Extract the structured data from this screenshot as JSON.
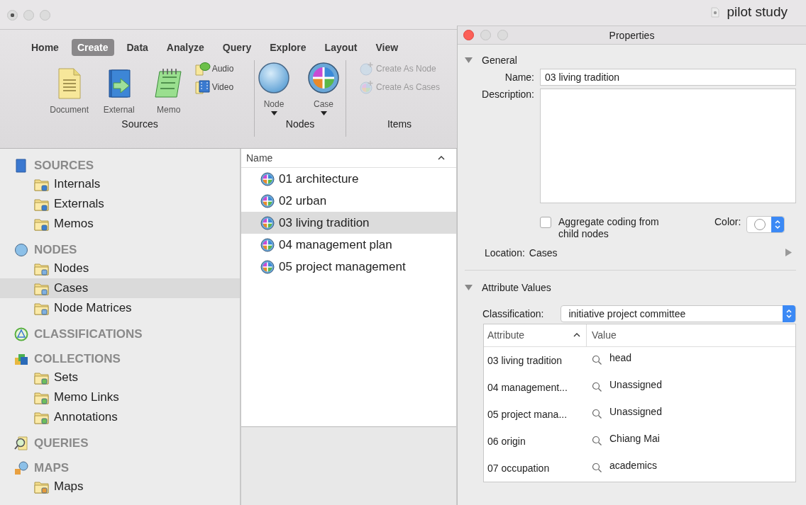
{
  "window": {
    "title": "pilot study"
  },
  "ribbon": {
    "tabs": [
      {
        "label": "Home",
        "selected": false
      },
      {
        "label": "Create",
        "selected": true
      },
      {
        "label": "Data",
        "selected": false
      },
      {
        "label": "Analyze",
        "selected": false
      },
      {
        "label": "Query",
        "selected": false
      },
      {
        "label": "Explore",
        "selected": false
      },
      {
        "label": "Layout",
        "selected": false
      },
      {
        "label": "View",
        "selected": false
      }
    ],
    "groups": [
      {
        "label": "Sources",
        "buttons": [
          {
            "label": "Document",
            "kind": "large",
            "disabled": false,
            "menu": false
          },
          {
            "label": "External",
            "kind": "large",
            "disabled": false,
            "menu": false
          },
          {
            "label": "Memo",
            "kind": "large",
            "disabled": false,
            "menu": false
          },
          {
            "label": "Audio",
            "kind": "small",
            "disabled": false
          },
          {
            "label": "Video",
            "kind": "small",
            "disabled": false
          }
        ]
      },
      {
        "label": "Nodes",
        "buttons": [
          {
            "label": "Node",
            "kind": "large",
            "disabled": false,
            "menu": true
          },
          {
            "label": "Case",
            "kind": "large",
            "disabled": false,
            "menu": true
          }
        ]
      },
      {
        "label": "Items",
        "buttons": [
          {
            "label": "Create As Node",
            "kind": "small",
            "disabled": true
          },
          {
            "label": "Create As Cases",
            "kind": "small",
            "disabled": true
          }
        ]
      }
    ]
  },
  "sidebar": {
    "sections": [
      {
        "label": "SOURCES",
        "items": [
          {
            "label": "Internals",
            "selected": false
          },
          {
            "label": "Externals",
            "selected": false
          },
          {
            "label": "Memos",
            "selected": false
          }
        ]
      },
      {
        "label": "NODES",
        "items": [
          {
            "label": "Nodes",
            "selected": false
          },
          {
            "label": "Cases",
            "selected": true
          },
          {
            "label": "Node Matrices",
            "selected": false
          }
        ]
      },
      {
        "label": "CLASSIFICATIONS"
      },
      {
        "label": "COLLECTIONS",
        "items": [
          {
            "label": "Sets",
            "selected": false
          },
          {
            "label": "Memo Links",
            "selected": false
          },
          {
            "label": "Annotations",
            "selected": false
          }
        ]
      },
      {
        "label": "QUERIES"
      },
      {
        "label": "MAPS",
        "items": [
          {
            "label": "Maps",
            "selected": false
          }
        ]
      }
    ]
  },
  "list": {
    "columns": [
      "Name"
    ],
    "rows": [
      {
        "label": "01 architecture",
        "selected": false
      },
      {
        "label": "02 urban",
        "selected": false
      },
      {
        "label": "03 living tradition",
        "selected": true
      },
      {
        "label": "04 management plan",
        "selected": false
      },
      {
        "label": "05 project management",
        "selected": false
      }
    ]
  },
  "properties": {
    "title": "Properties",
    "general": {
      "label": "General",
      "expanded": true,
      "name_label": "Name:",
      "name_value": "03 living tradition",
      "description_label": "Description:",
      "aggregate": {
        "label": "Aggregate coding from child nodes",
        "checked": false
      },
      "color_label": "Color:",
      "location_label": "Location:",
      "location_value": "Cases"
    },
    "attributes": {
      "label": "Attribute Values",
      "expanded": true,
      "classification_label": "Classification:",
      "classification_value": "initiative project committee",
      "columns": [
        "Attribute",
        "Value"
      ],
      "rows": [
        {
          "attribute": "03 living tradition",
          "value": "head"
        },
        {
          "attribute": "04 management...",
          "value": "Unassigned"
        },
        {
          "attribute": "05 project mana...",
          "value": "Unassigned"
        },
        {
          "attribute": "06 origin",
          "value": "Chiang Mai"
        },
        {
          "attribute": "07 occupation",
          "value": "academics"
        }
      ]
    }
  }
}
